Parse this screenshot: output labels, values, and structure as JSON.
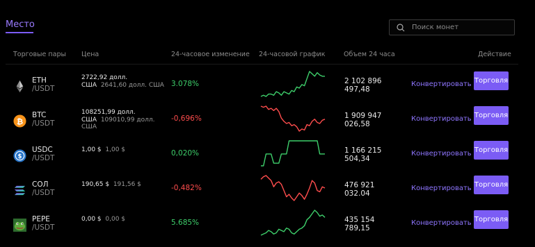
{
  "tabs": {
    "active": "Место"
  },
  "search": {
    "placeholder": "Поиск монет"
  },
  "headers": {
    "pairs": "Торговые пары",
    "price": "Цена",
    "change": "24-часовое изменение",
    "chart": "24-часовой график",
    "volume": "Объем 24 часа",
    "action": "Действие"
  },
  "rows": [
    {
      "symbol": "ETH",
      "quote": "/USDT",
      "icon": "ethereum-icon",
      "price_main": "2722,92 долл. США",
      "price_orig": "2641,60 долл. США",
      "change": "3.078%",
      "direction": "up",
      "volume_line1": "2 102 896",
      "volume_line2": "497,48",
      "convert": "Конвертировать",
      "trade": "Торговля",
      "spark": [
        5,
        6,
        5,
        7,
        7,
        6,
        9,
        8,
        6,
        9,
        8,
        7,
        10,
        9,
        13,
        12,
        15,
        14,
        20,
        26,
        24,
        22,
        25,
        23,
        22,
        22
      ]
    },
    {
      "symbol": "BTC",
      "quote": "/USDT",
      "icon": "bitcoin-icon",
      "price_main": "108251,99 долл. США",
      "price_orig": "109010,99 долл. США",
      "change": "-0,696%",
      "direction": "down",
      "volume_line1": "1 909 947",
      "volume_line2": "026,58",
      "convert": "Конвертировать",
      "trade": "Торговля",
      "spark": [
        27,
        26,
        27,
        24,
        25,
        23,
        25,
        22,
        16,
        13,
        11,
        12,
        9,
        10,
        8,
        4,
        6,
        5,
        10,
        9,
        13,
        15,
        12,
        11,
        14,
        15
      ]
    },
    {
      "symbol": "USDC",
      "quote": "/USDT",
      "icon": "usdc-icon",
      "price_main": "1,00 $",
      "price_orig": "1,00 $",
      "change": "0,020%",
      "direction": "up",
      "volume_line1": "1 166 215",
      "volume_line2": "504,34",
      "convert": "Конвертировать",
      "trade": "Торговля",
      "spark": [
        5,
        5,
        14,
        14,
        14,
        7,
        7,
        7,
        14,
        14,
        14,
        24,
        24,
        24,
        24,
        24,
        24,
        24,
        24,
        24,
        24,
        24,
        24,
        14,
        14,
        14
      ]
    },
    {
      "symbol": "СОЛ",
      "quote": "/USDT",
      "icon": "solana-icon",
      "price_main": "190,65 $",
      "price_orig": "191,56 $",
      "change": "-0,482%",
      "direction": "down",
      "volume_line1": "476 921",
      "volume_line2": "032.04",
      "convert": "Конвертировать",
      "trade": "Торговля",
      "spark": [
        23,
        25,
        26,
        24,
        22,
        17,
        20,
        21,
        19,
        14,
        9,
        11,
        8,
        6,
        9,
        12,
        10,
        7,
        11,
        16,
        22,
        20,
        14,
        13,
        17,
        16
      ]
    },
    {
      "symbol": "PEPE",
      "quote": "/USDT",
      "icon": "pepe-icon",
      "price_main": "0,00 $",
      "price_orig": "0,00 $",
      "change": "5.685%",
      "direction": "up",
      "volume_line1": "435 154",
      "volume_line2": "789,15",
      "convert": "Конвертировать",
      "trade": "Торговля",
      "spark": [
        4,
        5,
        6,
        8,
        7,
        5,
        6,
        9,
        8,
        7,
        10,
        9,
        6,
        5,
        7,
        9,
        10,
        12,
        17,
        19,
        22,
        25,
        23,
        20,
        21,
        19
      ]
    }
  ],
  "colors": {
    "accent": "#7b5cf5",
    "up": "#3ecf6b",
    "down": "#ff4d4d"
  }
}
